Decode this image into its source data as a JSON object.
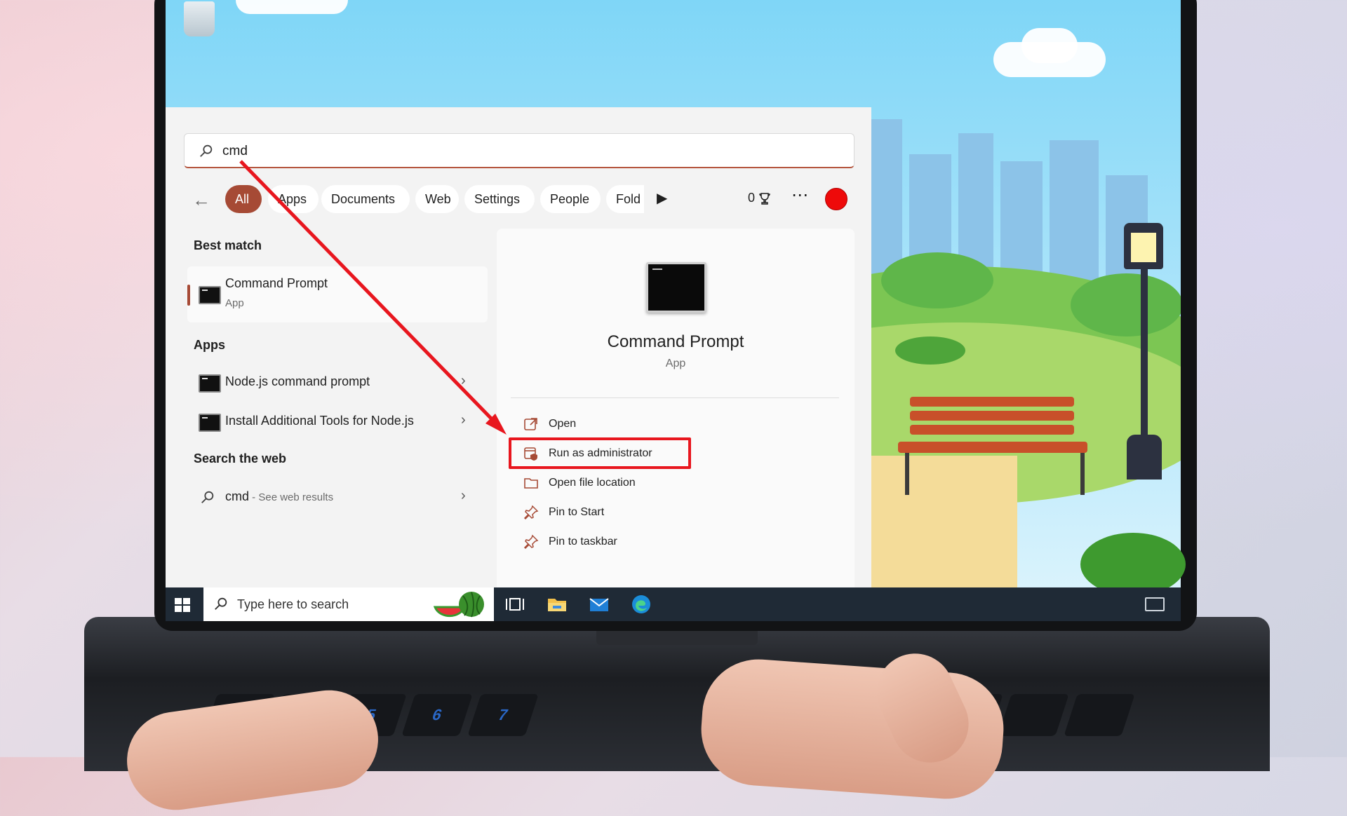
{
  "search": {
    "value": "cmd"
  },
  "filters": {
    "back": "←",
    "tabs": [
      "All",
      "Apps",
      "Documents",
      "Web",
      "Settings",
      "People",
      "Fold"
    ],
    "points": "0"
  },
  "results": {
    "best_match_heading": "Best match",
    "best_match": {
      "title": "Command Prompt",
      "subtitle": "App"
    },
    "apps_heading": "Apps",
    "apps": [
      {
        "label": "Node.js command prompt"
      },
      {
        "label": "Install Additional Tools for Node.js"
      }
    ],
    "web_heading": "Search the web",
    "web": {
      "query": "cmd",
      "suffix": " - See web results"
    }
  },
  "detail": {
    "title": "Command Prompt",
    "subtitle": "App",
    "actions": [
      {
        "label": "Open",
        "icon": "open-icon"
      },
      {
        "label": "Run as administrator",
        "icon": "shield-icon"
      },
      {
        "label": "Open file location",
        "icon": "folder-icon"
      },
      {
        "label": "Pin to Start",
        "icon": "pin-icon"
      },
      {
        "label": "Pin to taskbar",
        "icon": "pin-icon"
      }
    ]
  },
  "taskbar": {
    "search_placeholder": "Type here to search"
  },
  "colors": {
    "accent": "#a64a35",
    "highlight": "#e8161e",
    "taskbar": "#1f2a36"
  }
}
